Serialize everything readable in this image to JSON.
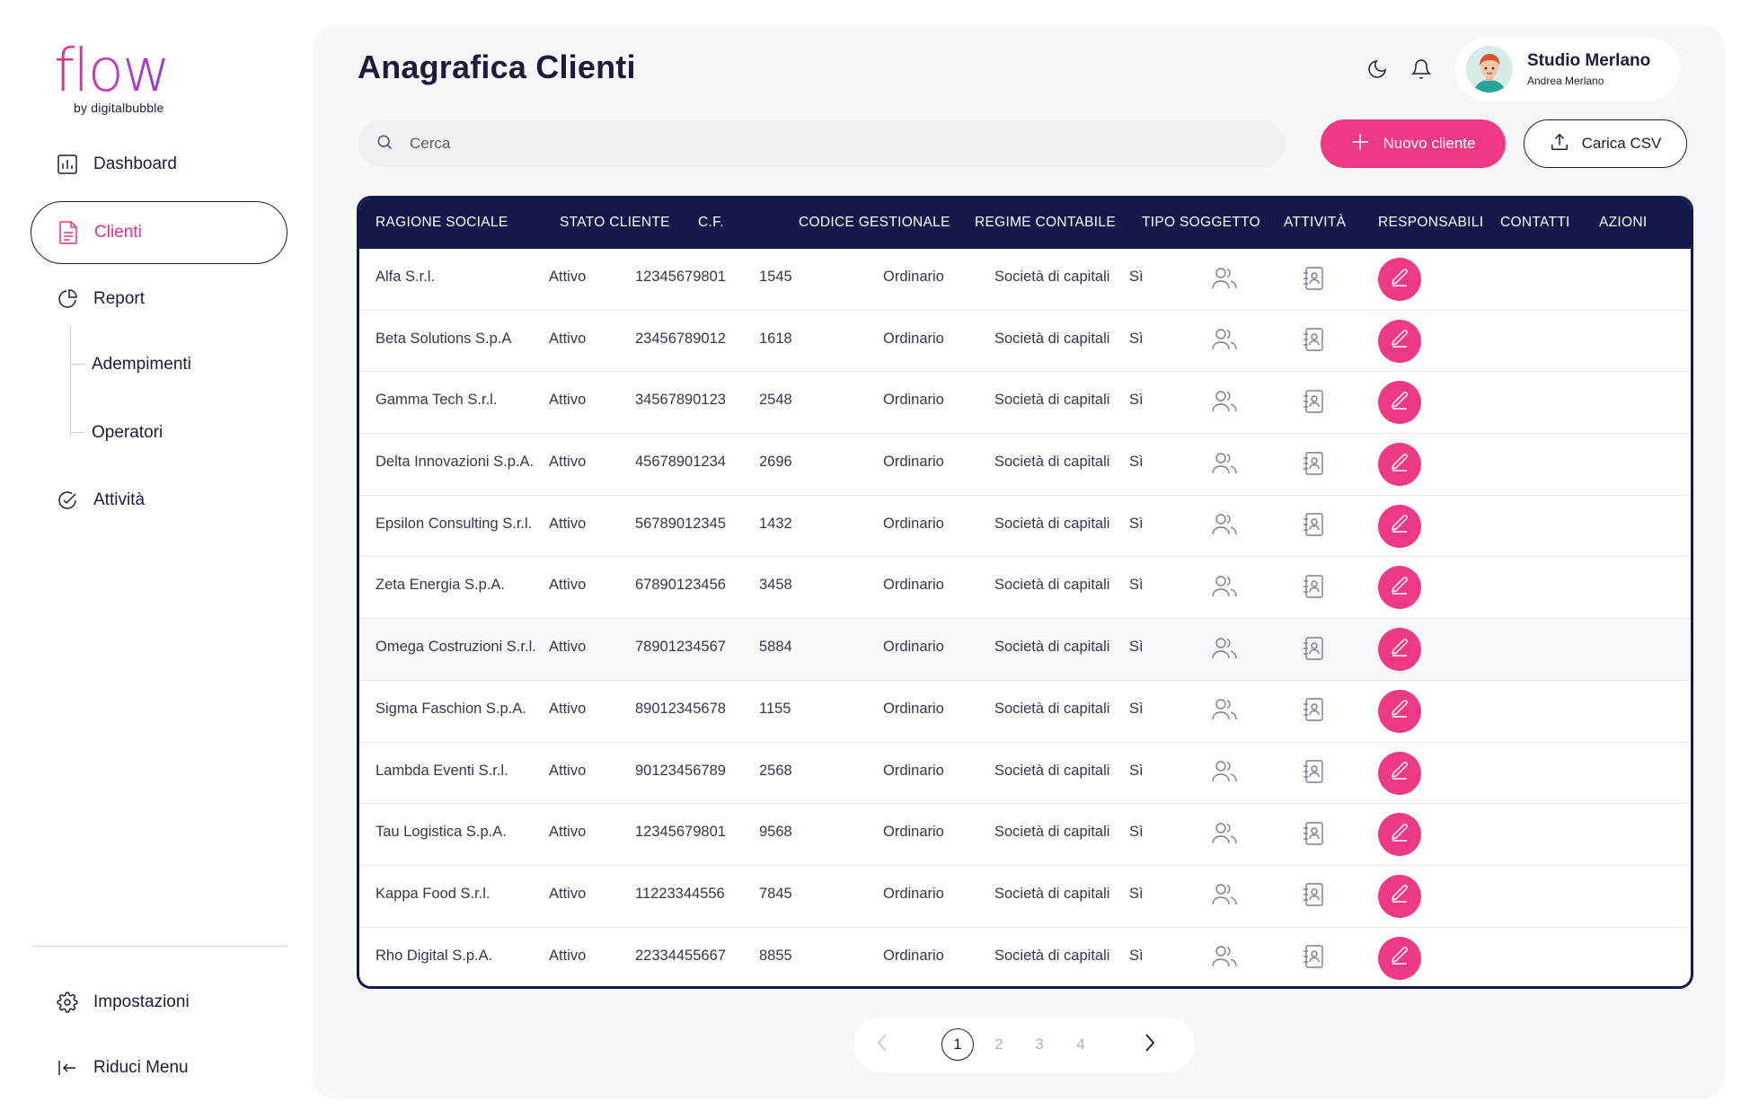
{
  "brand": {
    "name": "flow",
    "tagline": "by digitalbubble"
  },
  "sidebar": {
    "items": [
      {
        "label": "Dashboard",
        "icon": "bar-chart-icon"
      },
      {
        "label": "Clienti",
        "icon": "document-icon",
        "active": true
      },
      {
        "label": "Report",
        "icon": "pie-chart-icon"
      },
      {
        "label": "Attività",
        "icon": "check-circle-icon"
      }
    ],
    "subitems": [
      {
        "label": "Adempimenti"
      },
      {
        "label": "Operatori"
      }
    ],
    "bottom": [
      {
        "label": "Impostazioni",
        "icon": "gear-icon"
      },
      {
        "label": "Riduci Menu",
        "icon": "collapse-left-icon"
      }
    ]
  },
  "header": {
    "title": "Anagrafica Clienti",
    "user": {
      "name": "Studio Merlano",
      "subtitle": "Andrea Merlano"
    }
  },
  "search": {
    "placeholder": "Cerca",
    "value": ""
  },
  "actions": {
    "new_label": "Nuovo cliente",
    "csv_label": "Carica CSV"
  },
  "colors": {
    "accent": "#ee3a84",
    "navy": "#15184a",
    "text": "#1b1c3d"
  },
  "table": {
    "columns": [
      "RAGIONE SOCIALE",
      "STATO CLIENTE",
      "C.F.",
      "CODICE GESTIONALE",
      "REGIME CONTABILE",
      "TIPO SOGGETTO",
      "ATTIVITÀ",
      "RESPONSABILI",
      "CONTATTI",
      "AZIONI"
    ],
    "rows": [
      {
        "name": "Alfa S.r.l.",
        "status": "Attivo",
        "cf": "12345679801",
        "code": "1545",
        "regime": "Ordinario",
        "tipo": "Società di capitali",
        "attivita": "Sì"
      },
      {
        "name": "Beta Solutions S.p.A",
        "status": "Attivo",
        "cf": "23456789012",
        "code": "1618",
        "regime": "Ordinario",
        "tipo": "Società di capitali",
        "attivita": "Sì"
      },
      {
        "name": "Gamma Tech S.r.l.",
        "status": "Attivo",
        "cf": "34567890123",
        "code": "2548",
        "regime": "Ordinario",
        "tipo": "Società di capitali",
        "attivita": "Sì"
      },
      {
        "name": "Delta Innovazioni S.p.A.",
        "status": "Attivo",
        "cf": "45678901234",
        "code": "2696",
        "regime": "Ordinario",
        "tipo": "Società di capitali",
        "attivita": "Sì"
      },
      {
        "name": "Epsilon Consulting S.r.l.",
        "status": "Attivo",
        "cf": "56789012345",
        "code": "1432",
        "regime": "Ordinario",
        "tipo": "Società di capitali",
        "attivita": "Sì"
      },
      {
        "name": "Zeta Energia S.p.A.",
        "status": "Attivo",
        "cf": "67890123456",
        "code": "3458",
        "regime": "Ordinario",
        "tipo": "Società di capitali",
        "attivita": "Sì"
      },
      {
        "name": "Omega Costruzioni S.r.l.",
        "status": "Attivo",
        "cf": "78901234567",
        "code": "5884",
        "regime": "Ordinario",
        "tipo": "Società di capitali",
        "attivita": "Sì"
      },
      {
        "name": "Sigma Faschion S.p.A.",
        "status": "Attivo",
        "cf": "89012345678",
        "code": "1155",
        "regime": "Ordinario",
        "tipo": "Società di capitali",
        "attivita": "Sì"
      },
      {
        "name": "Lambda Eventi S.r.l.",
        "status": "Attivo",
        "cf": "90123456789",
        "code": "2568",
        "regime": "Ordinario",
        "tipo": "Società di capitali",
        "attivita": "Sì"
      },
      {
        "name": "Tau Logistica S.p.A.",
        "status": "Attivo",
        "cf": "12345679801",
        "code": "9568",
        "regime": "Ordinario",
        "tipo": "Società di capitali",
        "attivita": "Sì"
      },
      {
        "name": "Kappa Food S.r.l.",
        "status": "Attivo",
        "cf": "11223344556",
        "code": "7845",
        "regime": "Ordinario",
        "tipo": "Società di capitali",
        "attivita": "Sì"
      },
      {
        "name": "Rho Digital S.p.A.",
        "status": "Attivo",
        "cf": "22334455667",
        "code": "8855",
        "regime": "Ordinario",
        "tipo": "Società di capitali",
        "attivita": "Sì"
      }
    ],
    "highlighted_row": 6
  },
  "pagination": {
    "pages": [
      "1",
      "2",
      "3",
      "4"
    ],
    "current": "1"
  }
}
